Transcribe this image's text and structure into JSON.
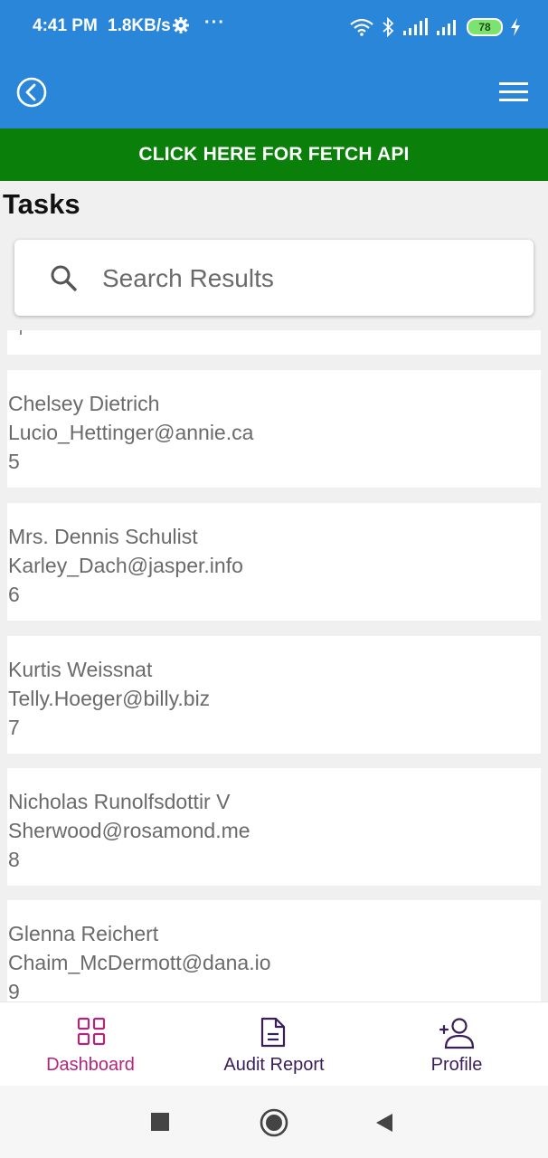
{
  "status_bar": {
    "time": "4:41 PM",
    "net_speed": "1.8KB/s",
    "dots": "···",
    "battery": "78",
    "icons": [
      "gear-icon",
      "wifi-icon",
      "bluetooth-icon",
      "signal-icon",
      "signal-icon",
      "battery-icon",
      "charging-icon"
    ]
  },
  "app_bar": {
    "back_icon": "back-circle-icon",
    "menu_icon": "hamburger-menu-icon"
  },
  "fetch_button": {
    "label": "CLICK HERE FOR FETCH API"
  },
  "page": {
    "title": "Tasks"
  },
  "search": {
    "placeholder": "Search Results",
    "value": "",
    "icon": "search-icon"
  },
  "tasks": [
    {
      "name": "Chelsey Dietrich",
      "email": "Lucio_Hettinger@annie.ca",
      "id": "5"
    },
    {
      "name": "Mrs. Dennis Schulist",
      "email": "Karley_Dach@jasper.info",
      "id": "6"
    },
    {
      "name": "Kurtis Weissnat",
      "email": "Telly.Hoeger@billy.biz",
      "id": "7"
    },
    {
      "name": "Nicholas Runolfsdottir V",
      "email": "Sherwood@rosamond.me",
      "id": "8"
    },
    {
      "name": "Glenna Reichert",
      "email": "Chaim_McDermott@dana.io",
      "id": "9"
    }
  ],
  "bottom_nav": [
    {
      "label": "Dashboard",
      "icon": "dashboard-grid-icon",
      "active": true
    },
    {
      "label": "Audit Report",
      "icon": "document-icon",
      "active": false
    },
    {
      "label": "Profile",
      "icon": "add-user-icon",
      "active": false
    }
  ],
  "colors": {
    "header": "#2a86d8",
    "fetch_button": "#0a7f0a",
    "active_nav": "#b3247c",
    "nav_text": "#3a1e5a",
    "list_text": "#6a6a6a"
  }
}
